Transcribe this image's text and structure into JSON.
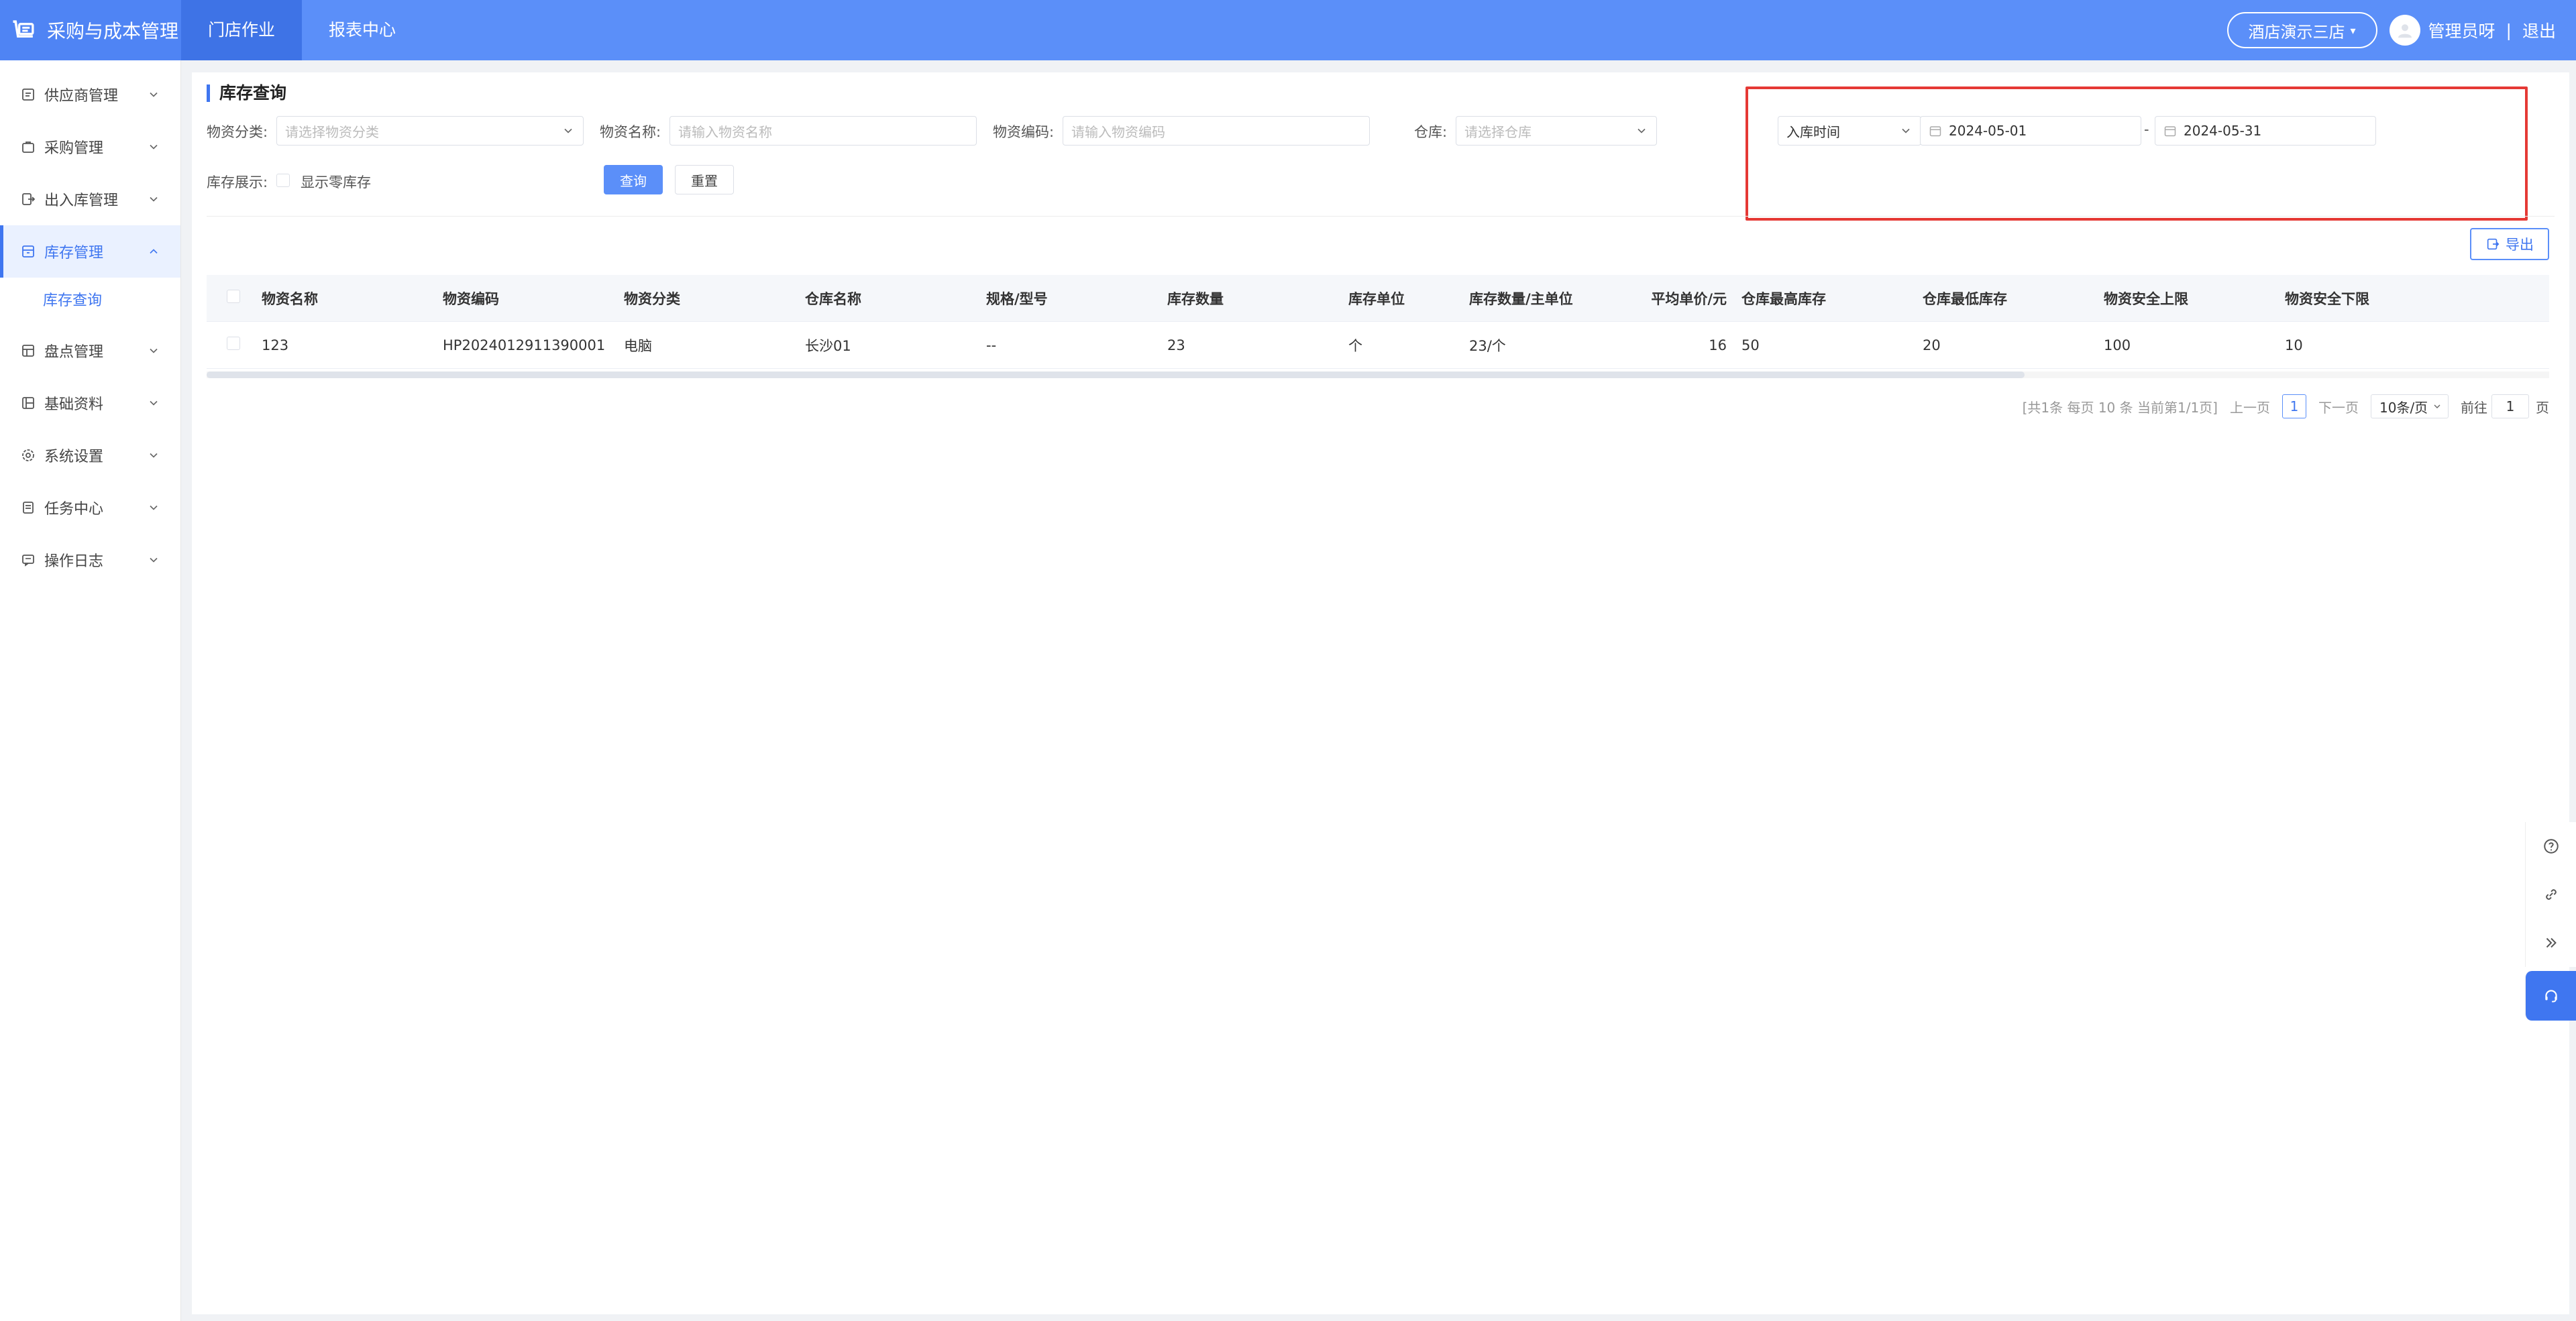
{
  "header": {
    "app_title": "采购与成本管理",
    "nav": [
      "门店作业",
      "报表中心"
    ],
    "store": "酒店演示三店",
    "user": "管理员呀",
    "separator": "|",
    "logout": "退出"
  },
  "sidebar": {
    "items": [
      {
        "label": "供应商管理",
        "icon": "supplier-icon"
      },
      {
        "label": "采购管理",
        "icon": "purchase-icon"
      },
      {
        "label": "出入库管理",
        "icon": "inout-icon"
      },
      {
        "label": "库存管理",
        "icon": "inventory-icon"
      },
      {
        "label": "盘点管理",
        "icon": "stocktake-icon"
      },
      {
        "label": "基础资料",
        "icon": "basedata-icon"
      },
      {
        "label": "系统设置",
        "icon": "settings-icon"
      },
      {
        "label": "任务中心",
        "icon": "task-icon"
      },
      {
        "label": "操作日志",
        "icon": "log-icon"
      }
    ],
    "sub_active": "库存查询"
  },
  "page": {
    "title": "库存查询"
  },
  "filters": {
    "category_label": "物资分类:",
    "category_placeholder": "请选择物资分类",
    "name_label": "物资名称:",
    "name_placeholder": "请输入物资名称",
    "code_label": "物资编码:",
    "code_placeholder": "请输入物资编码",
    "warehouse_label": "仓库:",
    "warehouse_placeholder": "请选择仓库",
    "date_type": "入库时间",
    "date_start": "2024-05-01",
    "date_sep": "-",
    "date_end": "2024-05-31",
    "display_label": "库存展示:",
    "zero_stock": "显示零库存",
    "query": "查询",
    "reset": "重置",
    "export": "导出"
  },
  "table": {
    "columns": [
      "物资名称",
      "物资编码",
      "物资分类",
      "仓库名称",
      "规格/型号",
      "库存数量",
      "库存单位",
      "库存数量/主单位",
      "平均单价/元",
      "仓库最高库存",
      "仓库最低库存",
      "物资安全上限",
      "物资安全下限"
    ],
    "rows": [
      [
        "123",
        "HP2024012911390001",
        "电脑",
        "长沙01",
        "--",
        "23",
        "个",
        "23/个",
        "16",
        "50",
        "20",
        "100",
        "10"
      ]
    ]
  },
  "pagination": {
    "summary": "[共1条 每页 10 条 当前第1/1页]",
    "prev": "上一页",
    "current": "1",
    "next": "下一页",
    "page_size": "10条/页",
    "goto_label": "前往",
    "goto_value": "1",
    "goto_suffix": "页"
  },
  "colors": {
    "primary": "#5b8ff9",
    "highlight": "#e53935"
  }
}
